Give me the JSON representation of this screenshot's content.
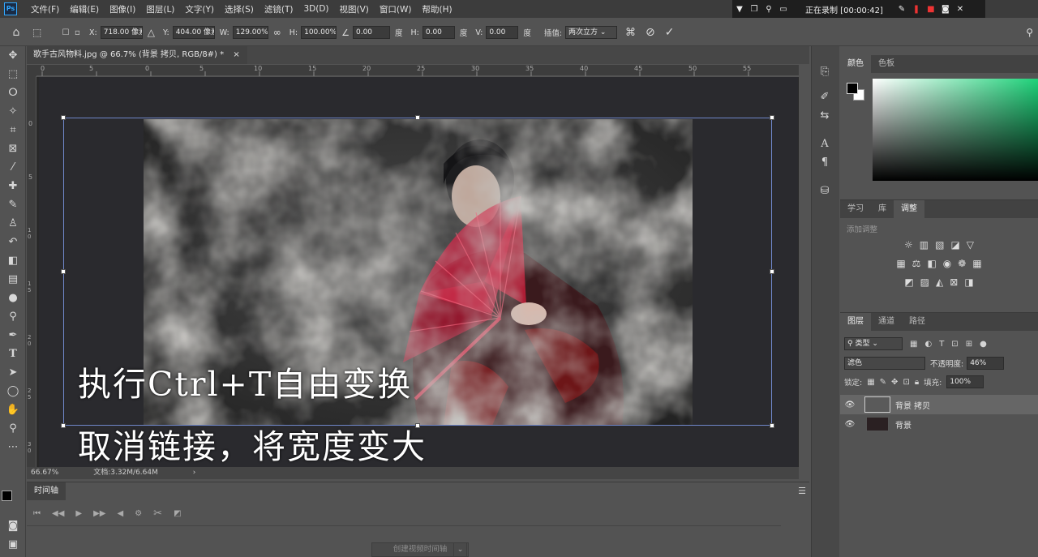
{
  "app": {
    "logo": "Ps"
  },
  "menu": [
    "文件(F)",
    "编辑(E)",
    "图像(I)",
    "图层(L)",
    "文字(Y)",
    "选择(S)",
    "滤镜(T)",
    "3D(D)",
    "视图(V)",
    "窗口(W)",
    "帮助(H)"
  ],
  "recorder": {
    "status": "正在录制 [00:00:42]"
  },
  "options": {
    "x_label": "X:",
    "x_value": "718.00 像素",
    "y_label": "Y:",
    "y_value": "404.00 像素",
    "w_label": "W:",
    "w_value": "129.00%",
    "h_label": "H:",
    "h_value": "100.00%",
    "angle_value": "0.00",
    "angle_unit": "度",
    "hskew_label": "H:",
    "hskew_value": "0.00",
    "hskew_unit": "度",
    "vskew_label": "V:",
    "vskew_value": "0.00",
    "vskew_unit": "度",
    "interp_label": "插值:",
    "interp_value": "两次立方"
  },
  "document": {
    "tab_title": "歌手古风物料.jpg @ 66.7% (背景 拷贝, RGB/8#) *",
    "close": "×",
    "ruler_h": [
      "0",
      "5",
      "0",
      "5",
      "10",
      "15",
      "20",
      "25",
      "30",
      "35",
      "40",
      "45",
      "50",
      "55"
    ],
    "ruler_v": [
      "0",
      "5",
      "1 0",
      "1 5",
      "2 0",
      "2 5",
      "3 0"
    ],
    "zoom": "66.67%",
    "doc_size": "文档:3.32M/6.64M",
    "caption_line1": "执行Ctrl+T自由变换",
    "caption_line2": "取消链接，将宽度变大"
  },
  "timeline": {
    "title": "时间轴",
    "create_button": "创建视频时间轴"
  },
  "color_panel": {
    "tabs": [
      "颜色",
      "色板"
    ],
    "accent": "#1fd27a"
  },
  "adjust_panel": {
    "tabs": [
      "学习",
      "库",
      "调整"
    ],
    "add_label": "添加调整"
  },
  "layers_panel": {
    "tabs": [
      "图层",
      "通道",
      "路径"
    ],
    "filter_kind": "类型",
    "blend_mode": "滤色",
    "opacity_label": "不透明度:",
    "opacity_value": "46%",
    "lock_label": "锁定:",
    "fill_label": "填充:",
    "fill_value": "100%",
    "layers": [
      {
        "name": "背景 拷贝"
      },
      {
        "name": "背景"
      }
    ]
  }
}
